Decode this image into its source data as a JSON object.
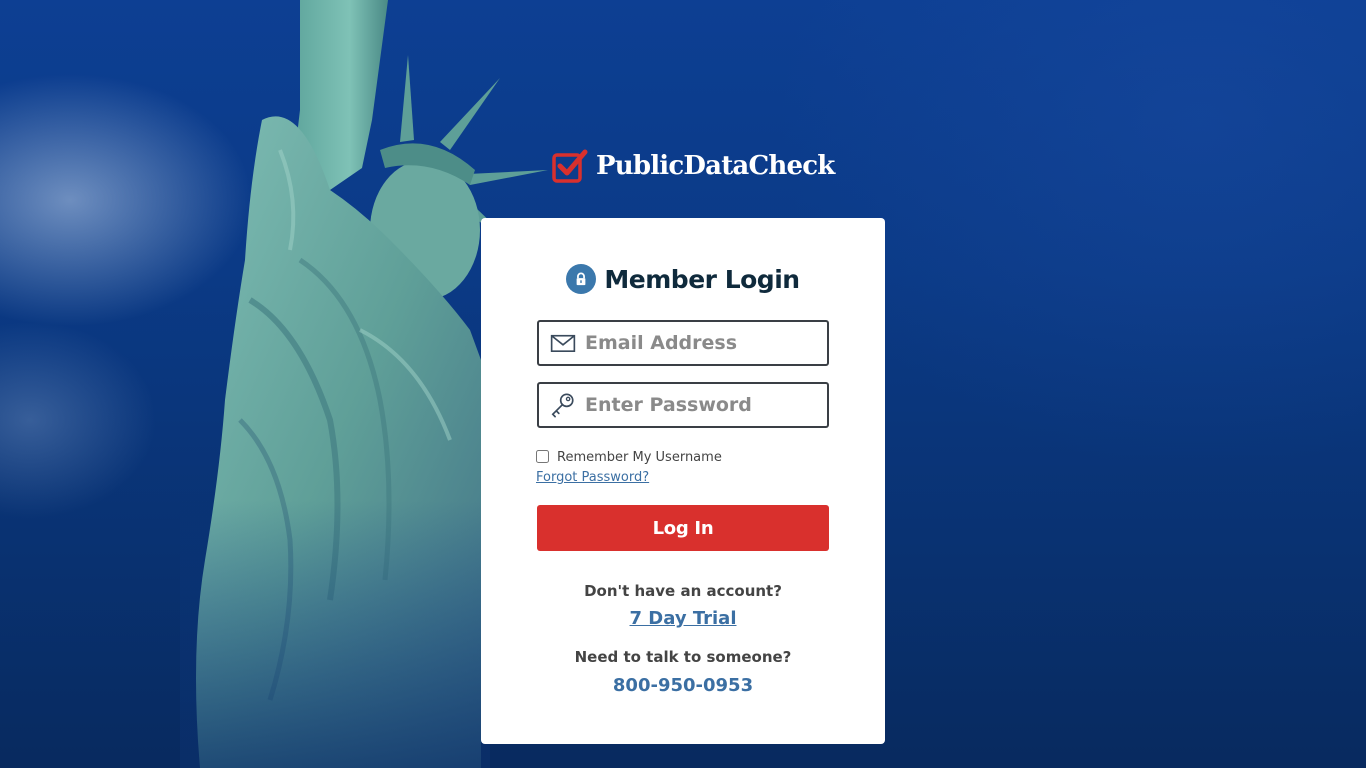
{
  "brand": {
    "name": "PublicDataCheck",
    "mark_color": "#d9302d"
  },
  "login": {
    "title": "Member Login",
    "email_placeholder": "Email Address",
    "password_placeholder": "Enter Password",
    "remember_label": "Remember My Username",
    "forgot_label": "Forgot Password?",
    "submit_label": "Log In",
    "submit_color": "#d9302d"
  },
  "signup": {
    "prompt": "Don't have an account?",
    "trial_label": "7 Day Trial"
  },
  "contact": {
    "prompt": "Need to talk to someone?",
    "phone": "800-950-0953"
  },
  "icons": {
    "title": "lock-icon",
    "email": "envelope-icon",
    "password": "key-icon",
    "logo": "checkbox-check-icon"
  },
  "colors": {
    "background": "#0b3a86",
    "link": "#3b6fa3",
    "title": "#0f2a3c"
  }
}
